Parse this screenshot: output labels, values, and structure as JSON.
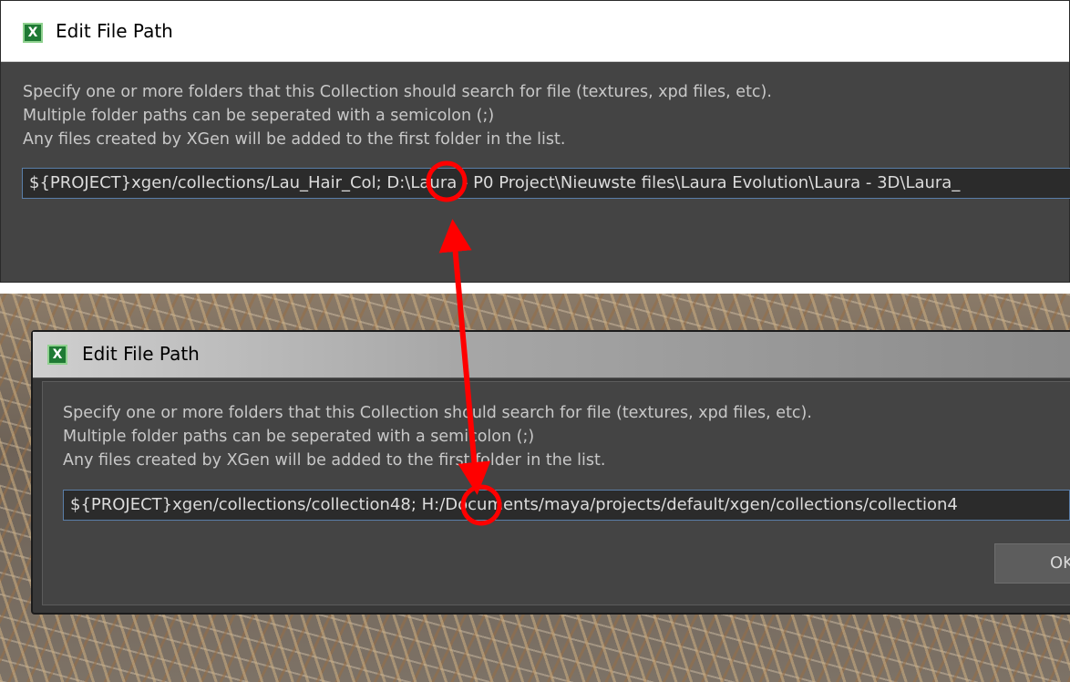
{
  "top_dialog": {
    "title": "Edit File Path",
    "icon": "x-app-icon",
    "description": [
      "Specify one or more folders that this Collection should search for file (textures, xpd files, etc).",
      "Multiple folder paths can be seperated with a semicolon (;)",
      "Any files created by XGen will be added to the first folder in the list."
    ],
    "path_value": "${PROJECT}xgen/collections/Lau_Hair_Col; D:\\Laura - P0 Project\\Nieuwste files\\Laura Evolution\\Laura - 3D\\Laura_"
  },
  "bottom_dialog": {
    "title": "Edit File Path",
    "icon": "x-app-icon",
    "description": [
      "Specify one or more folders that this Collection should search for file (textures, xpd files, etc).",
      "Multiple folder paths can be seperated with a semicolon (;)",
      "Any files created by XGen will be added to the first folder in the list."
    ],
    "path_value": "${PROJECT}xgen/collections/collection48; H:/Documents/maya/projects/default/xgen/collections/collection4",
    "ok_label": "OK"
  },
  "annotation": {
    "color": "#ff0000",
    "shapes": [
      "circle",
      "double-arrow",
      "circle"
    ]
  }
}
